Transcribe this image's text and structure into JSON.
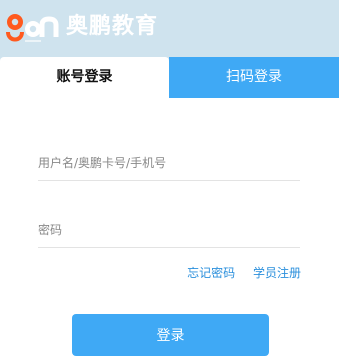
{
  "header": {
    "logo_icon": "open-logo-icon",
    "brand_name": "奥鹏教育"
  },
  "tabs": [
    {
      "label": "账号登录",
      "active": true
    },
    {
      "label": "扫码登录",
      "active": false
    }
  ],
  "form": {
    "username": {
      "placeholder": "用户名/奥鹏卡号/手机号",
      "value": ""
    },
    "password": {
      "placeholder": "密码",
      "value": ""
    }
  },
  "links": {
    "forgot_password": "忘记密码",
    "register": "学员注册"
  },
  "login_button": "登录",
  "colors": {
    "accent": "#3fa9f5",
    "header_bg": "#cfe3ee",
    "link": "#2a8fdc"
  }
}
